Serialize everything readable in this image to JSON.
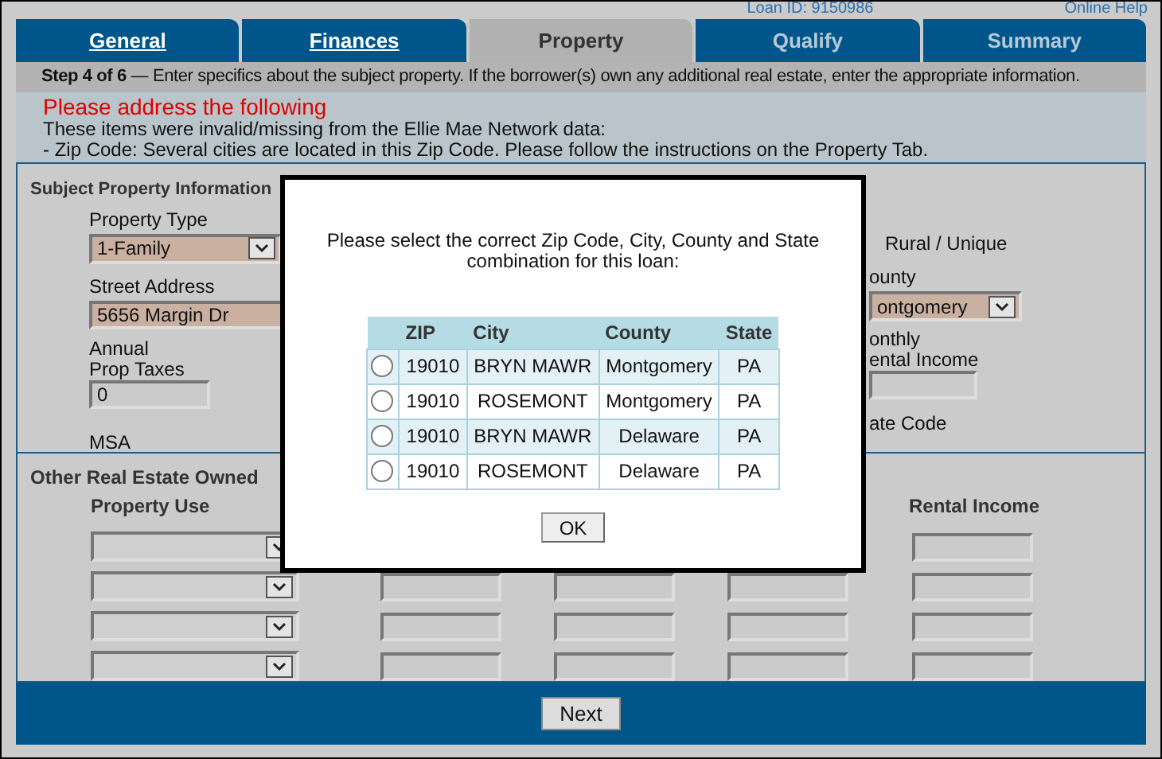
{
  "header": {
    "loan_id": "Loan ID: 9150986",
    "help_link": "Online Help"
  },
  "tabs": [
    {
      "label": "General",
      "selected": false,
      "disabled": false
    },
    {
      "label": "Finances",
      "selected": false,
      "disabled": false
    },
    {
      "label": "Property",
      "selected": true,
      "disabled": false
    },
    {
      "label": "Qualify",
      "selected": false,
      "disabled": true
    },
    {
      "label": "Summary",
      "selected": false,
      "disabled": true
    }
  ],
  "step_bar": "**Step 4 of 6** — Enter specifics about the subject property. If the borrower(s) own any additional real estate, enter the appropriate information.",
  "alert": {
    "title": "Please address the following",
    "lines": [
      "These items were invalid/missing from the Ellie Mae Network data:",
      "- Zip Code: Several cities are located in this Zip Code. Please follow the instructions on the Property Tab."
    ]
  },
  "subject_property": {
    "title": "Subject Property Information",
    "property_type_label": "Property Type",
    "property_type": "1-Family",
    "street_address_label": "Street Address",
    "street_address": "5656 Margin Dr",
    "prop_taxes_label": [
      "Annual",
      "Prop Taxes"
    ],
    "prop_taxes": "0",
    "msa_label": "MSA",
    "rural_label": "Rural / Unique",
    "county_label": "ounty",
    "county": "ontgomery",
    "rental_label": [
      "onthly",
      "ental Income"
    ],
    "state_code_label": "ate Code"
  },
  "other_real_estate": {
    "title": "Other Real Estate Owned",
    "property_use_label": "Property Use",
    "rental_income_label": "Rental Income",
    "rows": [
      {
        "kind": "under_dialog"
      },
      {
        "kind": "plain"
      },
      {
        "kind": "plain"
      },
      {
        "kind": "plain"
      }
    ]
  },
  "next_button": "Next",
  "dialog": {
    "message": "Please select the correct Zip Code, City, County and State combination for this loan:",
    "columns": [
      "ZIP",
      "City",
      "County",
      "State"
    ],
    "rows": [
      {
        "selected": false,
        "cells": [
          "19010",
          "BRYN MAWR",
          "Montgomery",
          "PA"
        ]
      },
      {
        "selected": false,
        "cells": [
          "19010",
          "ROSEMONT",
          "Montgomery",
          "PA"
        ]
      },
      {
        "selected": false,
        "cells": [
          "19010",
          "BRYN MAWR",
          "Delaware",
          "PA"
        ]
      },
      {
        "selected": false,
        "cells": [
          "19010",
          "ROSEMONT",
          "Delaware",
          "PA"
        ]
      }
    ],
    "ok_button": "OK"
  }
}
